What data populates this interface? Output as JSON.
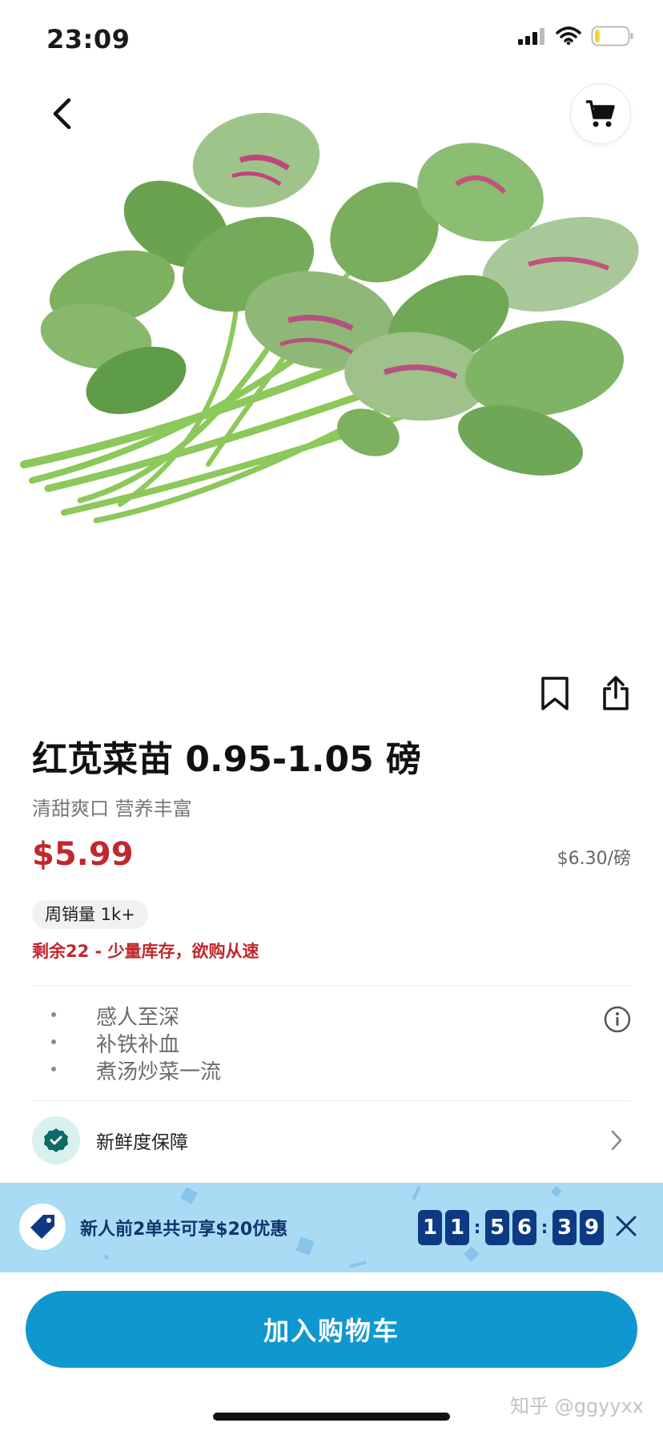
{
  "status_bar": {
    "time": "23:09",
    "battery_level": 0.15,
    "battery_color": "#f7d034"
  },
  "product": {
    "title": "红苋菜苗 0.95-1.05 磅",
    "subtitle": "清甜爽口 营养丰富",
    "price": "$5.99",
    "unit_price": "$6.30/磅",
    "weekly_sales": "周销量 1k+",
    "stock_note": "剩余22 - 少量库存，欲购从速",
    "features": [
      "感人至深",
      "补铁补血",
      "煮汤炒菜一流"
    ],
    "freshness_label": "新鲜度保障"
  },
  "promo": {
    "text": "新人前2单共可享$20优惠",
    "countdown": {
      "h1": "1",
      "h2": "1",
      "m1": "5",
      "m2": "6",
      "s1": "3",
      "s2": "9",
      "separator": ":"
    }
  },
  "cta": {
    "add_to_cart": "加入购物车"
  },
  "watermark": "知乎 @ggyyxx",
  "colors": {
    "price_red": "#c0282d",
    "cta_blue": "#0f97cf",
    "promo_bg": "#a9dcf4",
    "countdown_bg": "#0e3a83",
    "fresh_teal": "#0b6b66"
  },
  "icons": [
    "back-chevron-icon",
    "cart-icon",
    "bookmark-icon",
    "share-icon",
    "info-icon",
    "check-badge-icon",
    "chevron-right-icon",
    "tag-icon",
    "close-icon"
  ]
}
